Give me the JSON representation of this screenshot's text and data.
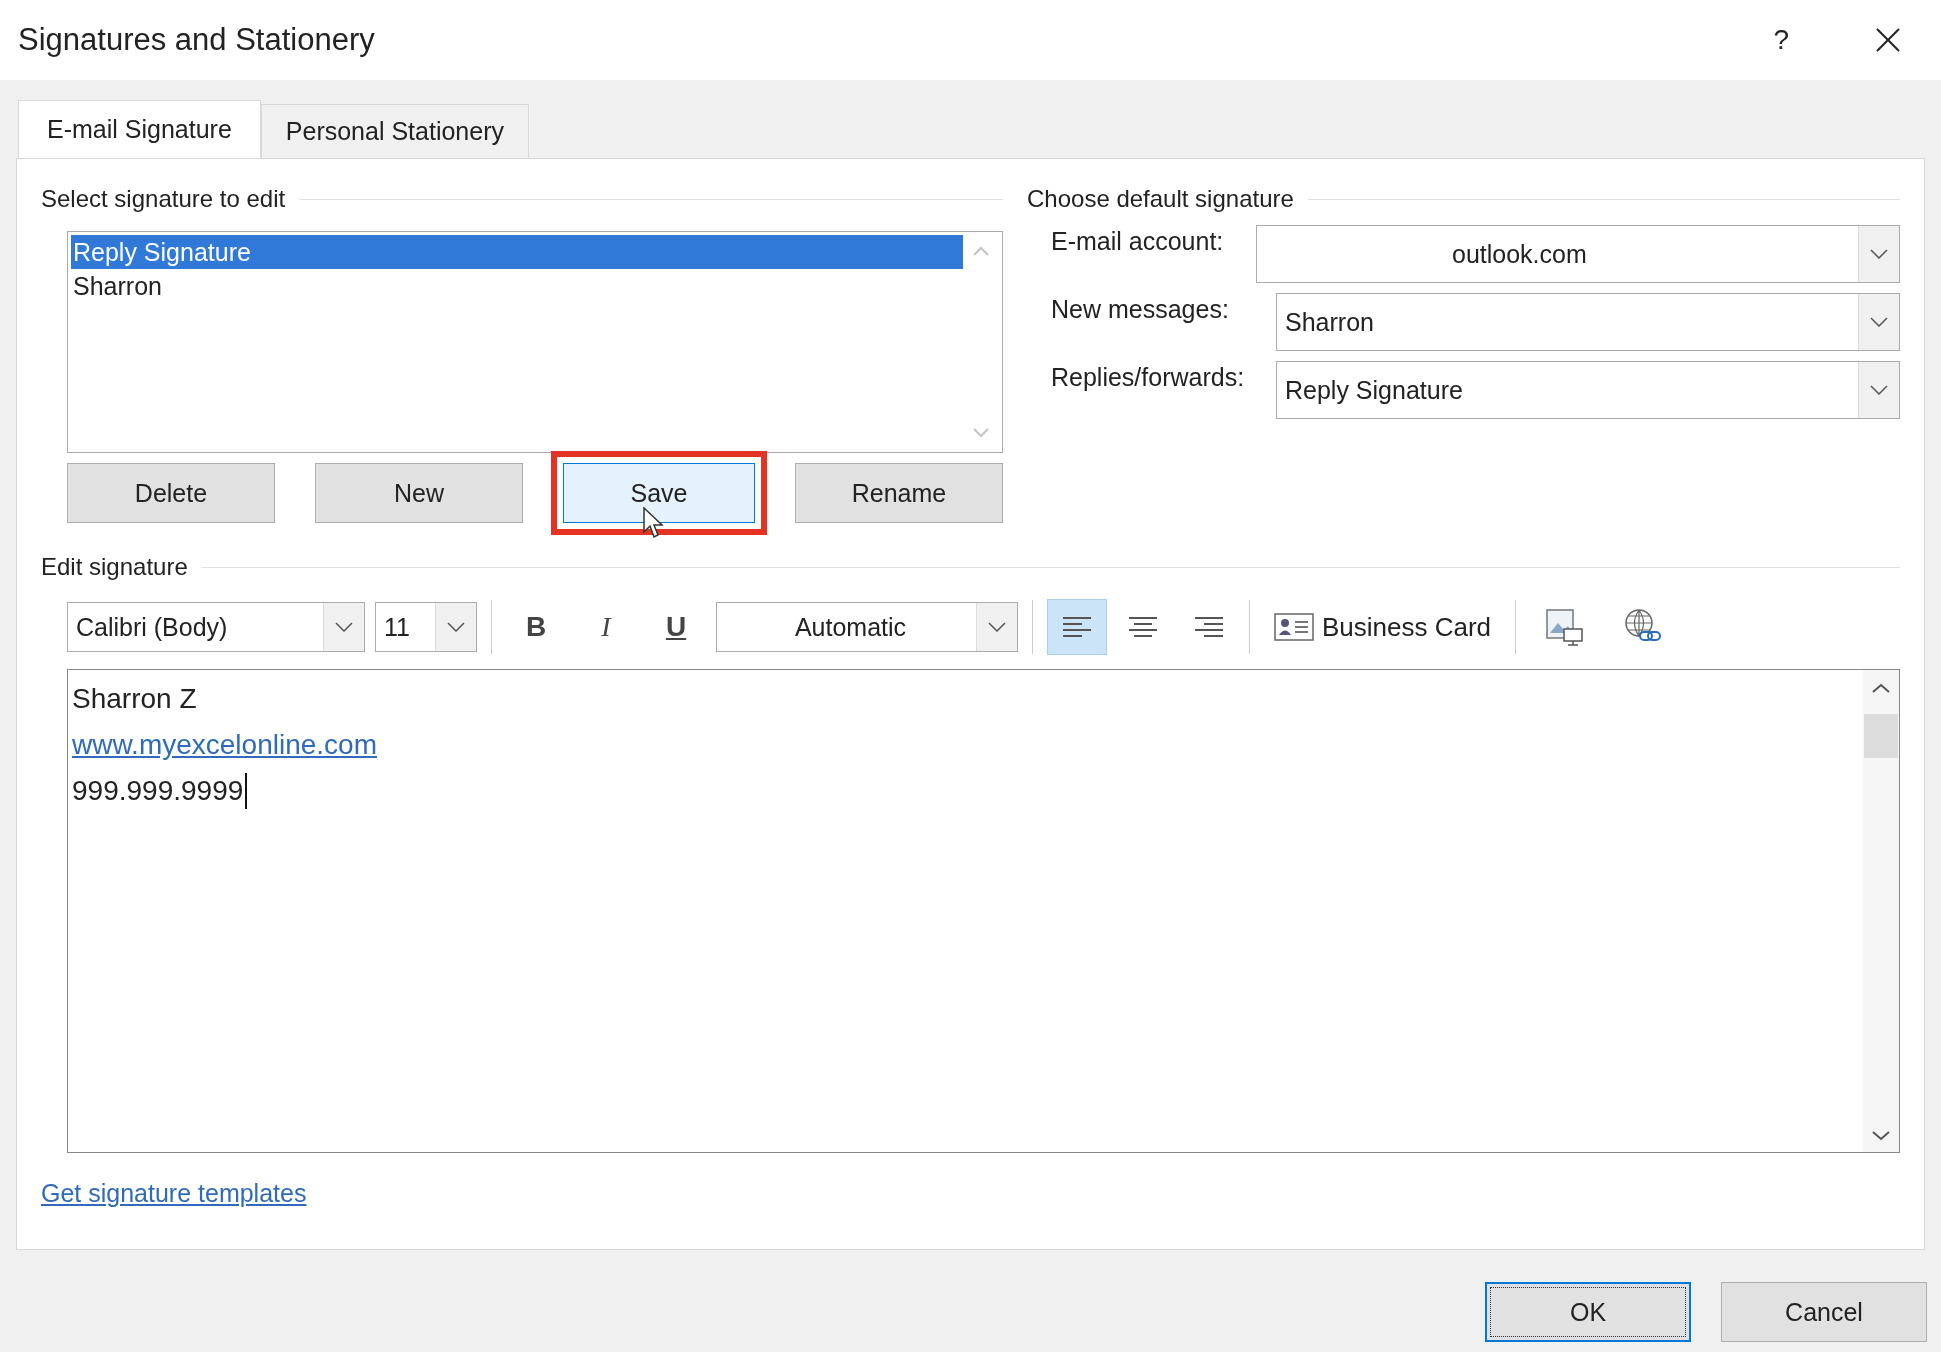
{
  "window": {
    "title": "Signatures and Stationery",
    "help": "?"
  },
  "tabs": [
    {
      "label": "E-mail Signature",
      "selected": true
    },
    {
      "label": "Personal Stationery",
      "selected": false
    }
  ],
  "select_signature": {
    "heading": "Select signature to edit",
    "items": [
      {
        "label": "Reply Signature",
        "selected": true
      },
      {
        "label": "Sharron",
        "selected": false
      }
    ],
    "buttons": [
      {
        "label": "Delete",
        "highlighted": false
      },
      {
        "label": "New",
        "highlighted": false
      },
      {
        "label": "Save",
        "highlighted": true
      },
      {
        "label": "Rename",
        "highlighted": false
      }
    ]
  },
  "default_signature": {
    "heading": "Choose default signature",
    "fields": [
      {
        "label": "E-mail account:",
        "value": "outlook.com",
        "kind": "account"
      },
      {
        "label": "New messages:",
        "value": "Sharron",
        "kind": "signature"
      },
      {
        "label": "Replies/forwards:",
        "value": "Reply Signature",
        "kind": "signature"
      }
    ]
  },
  "edit_signature": {
    "heading": "Edit signature",
    "toolbar": {
      "font": "Calibri (Body)",
      "size": "11",
      "bold": "B",
      "italic": "I",
      "underline": "U",
      "font_color_choice": "Automatic",
      "align": [
        {
          "kind": "left",
          "selected": true
        },
        {
          "kind": "center",
          "selected": false
        },
        {
          "kind": "right",
          "selected": false
        }
      ],
      "business_card": "Business Card"
    },
    "lines": [
      {
        "kind": "text",
        "text": "Sharron Z"
      },
      {
        "kind": "link",
        "text": "www.myexcelonline.com"
      },
      {
        "kind": "text",
        "text": "999.999.9999"
      }
    ]
  },
  "templates_link": "Get signature templates",
  "buttons": [
    {
      "label": "OK",
      "focused": true
    },
    {
      "label": "Cancel",
      "focused": false
    }
  ]
}
